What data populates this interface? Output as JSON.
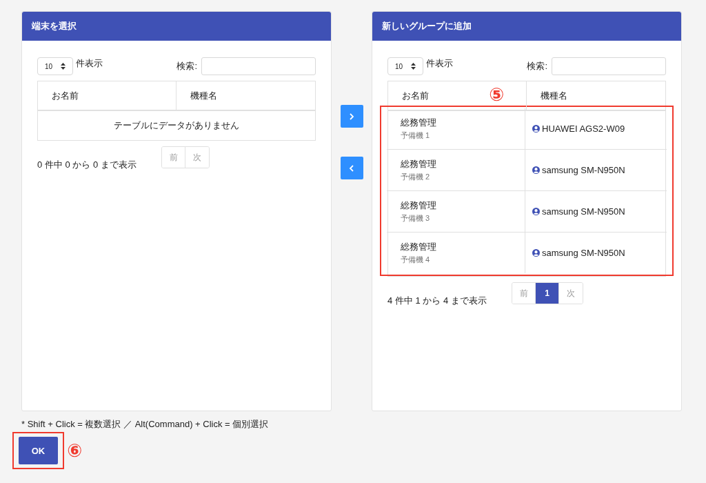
{
  "panels": [
    {
      "title": "端末を選択",
      "length_value": "10",
      "length_label": "件表示",
      "search_label": "検索:",
      "columns": [
        "お名前",
        "機種名"
      ],
      "empty_text": "テーブルにデータがありません",
      "info": "0 件中 0 から 0 まで表示",
      "pager": {
        "prev": "前",
        "next": "次"
      }
    },
    {
      "title": "新しいグループに追加",
      "length_value": "10",
      "length_label": "件表示",
      "search_label": "検索:",
      "columns": [
        "お名前",
        "機種名"
      ],
      "annotation": "⑤",
      "rows": [
        {
          "name": "総務管理",
          "sub": "予備機 1",
          "model": "HUAWEI AGS2-W09"
        },
        {
          "name": "総務管理",
          "sub": "予備機 2",
          "model": "samsung SM-N950N"
        },
        {
          "name": "総務管理",
          "sub": "予備機 3",
          "model": "samsung SM-N950N"
        },
        {
          "name": "総務管理",
          "sub": "予備機 4",
          "model": "samsung SM-N950N"
        }
      ],
      "info": "4 件中 1 から 4 まで表示",
      "pager": {
        "prev": "前",
        "pages": [
          {
            "label": "1",
            "selected": true
          }
        ],
        "next": "次"
      }
    }
  ],
  "move_buttons": [
    {
      "kind": "right"
    },
    {
      "kind": "left"
    }
  ],
  "hint": "* Shift + Click = 複数選択 ／ Alt(Command) + Click = 個別選択",
  "ok_button": {
    "label": "OK",
    "annotation": "⑥"
  }
}
